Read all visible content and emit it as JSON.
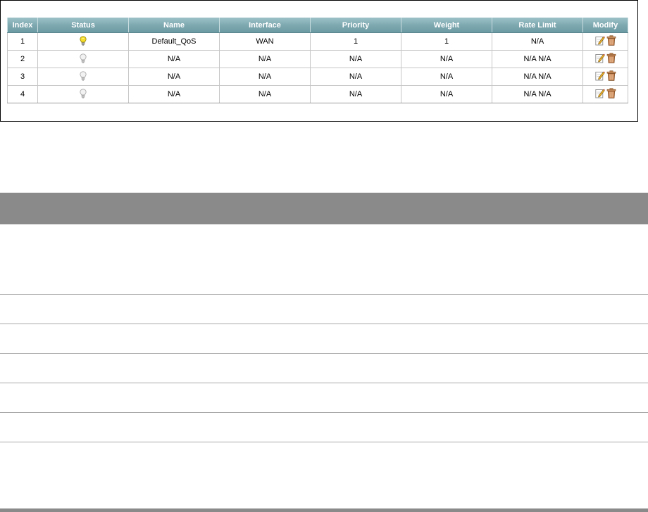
{
  "table": {
    "headers": {
      "index": "Index",
      "status": "Status",
      "name": "Name",
      "interface": "Interface",
      "priority": "Priority",
      "weight": "Weight",
      "rate_limit": "Rate Limit",
      "modify": "Modify"
    },
    "rows": [
      {
        "index": "1",
        "status": "on",
        "name": "Default_QoS",
        "interface": "WAN",
        "priority": "1",
        "weight": "1",
        "rate_limit": "N/A"
      },
      {
        "index": "2",
        "status": "off",
        "name": "N/A",
        "interface": "N/A",
        "priority": "N/A",
        "weight": "N/A",
        "rate_limit": "N/A N/A"
      },
      {
        "index": "3",
        "status": "off",
        "name": "N/A",
        "interface": "N/A",
        "priority": "N/A",
        "weight": "N/A",
        "rate_limit": "N/A N/A"
      },
      {
        "index": "4",
        "status": "off",
        "name": "N/A",
        "interface": "N/A",
        "priority": "N/A",
        "weight": "N/A",
        "rate_limit": "N/A N/A"
      }
    ]
  },
  "icons": {
    "status_on": "lightbulb-on-icon",
    "status_off": "lightbulb-off-icon",
    "edit": "edit-icon",
    "delete": "trash-icon"
  },
  "colors": {
    "header_bg": "#7fa9b1",
    "bulb_on": "#f2d31b",
    "bulb_off": "#d8d8d8",
    "doc_band": "#8a8a8a"
  }
}
